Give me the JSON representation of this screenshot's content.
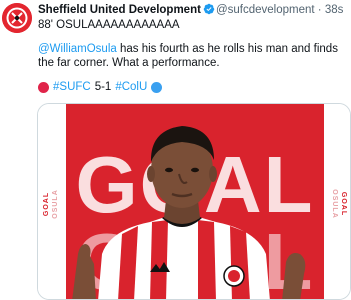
{
  "tweet": {
    "author_name": "Sheffield United Development",
    "handle": "@sufcdevelopment",
    "separator": "·",
    "time": "38s",
    "line1": "88' OSULAAAAAAAAAAAA",
    "mention": "@WilliamOsula",
    "body_rest": " has his fourth as he rolls his man and finds the far corner. What a performance.",
    "tag_home": "#SUFC",
    "score": "5-1",
    "tag_away": "#ColU"
  },
  "media": {
    "big_text": "GOAL",
    "side_word": "GOAL",
    "side_name": "OSULA"
  },
  "colors": {
    "accent": "#1d9bf0",
    "brand_red": "#e3262f",
    "away_blue": "#3aa0f0"
  },
  "icons": {
    "avatar": "club-crest-avatar",
    "verified": "verified-badge-icon",
    "home_dot": "red-circle-emoji",
    "away_dot": "blue-circle-emoji"
  }
}
